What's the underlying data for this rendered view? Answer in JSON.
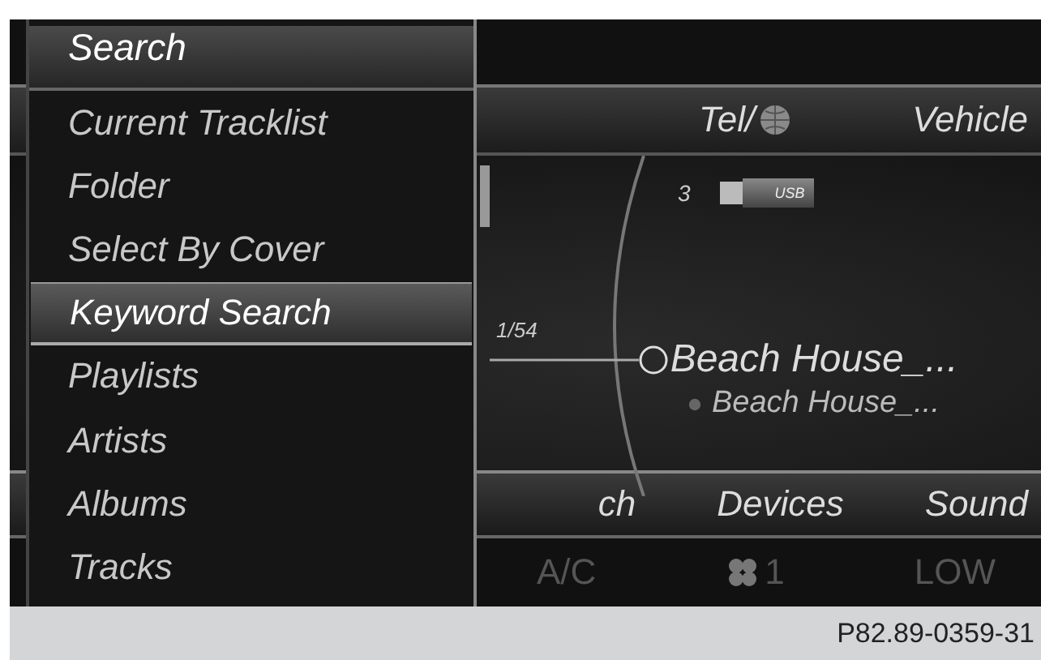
{
  "menu": {
    "title": "Search",
    "items": [
      {
        "label": "Current Tracklist",
        "selected": false
      },
      {
        "label": "Folder",
        "selected": false
      },
      {
        "label": "Select By Cover",
        "selected": false
      },
      {
        "label": "Keyword Search",
        "selected": true
      },
      {
        "label": "Playlists",
        "selected": false
      },
      {
        "label": "Artists",
        "selected": false
      },
      {
        "label": "Albums",
        "selected": false
      },
      {
        "label": "Tracks",
        "selected": false
      }
    ]
  },
  "top_tabs": [
    {
      "label": "Tel/",
      "globe": true
    },
    {
      "label": "Vehicle",
      "globe": false
    }
  ],
  "device": {
    "number": "3",
    "badge": "USB"
  },
  "track": {
    "index": "1/54",
    "title": "Beach House_...",
    "subtitle": "Beach House_..."
  },
  "bottom_tabs": [
    "ch",
    "Devices",
    "Sound"
  ],
  "climate": {
    "ac": "A/C",
    "fan": "1",
    "mode": "LOW"
  },
  "caption": "P82.89-0359-31"
}
